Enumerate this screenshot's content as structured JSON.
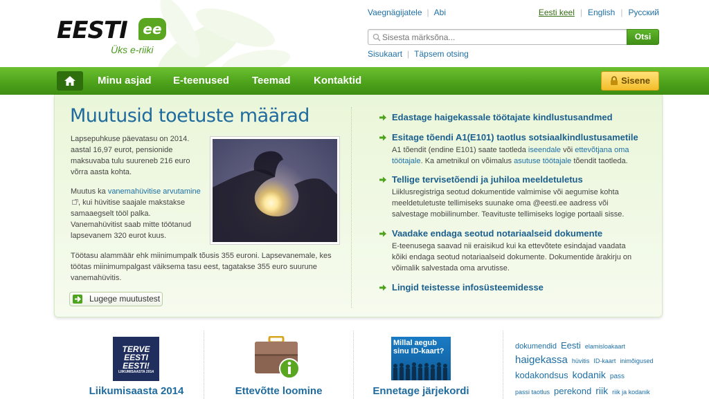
{
  "header": {
    "logo_text": "EESTI",
    "logo_ee": "ee",
    "logo_tagline": "Üks e-riiki",
    "top_links": [
      "Vaegnägijatele",
      "Abi"
    ],
    "languages": [
      {
        "label": "Eesti keel",
        "active": true
      },
      {
        "label": "English",
        "active": false
      },
      {
        "label": "Русский",
        "active": false
      }
    ],
    "search": {
      "placeholder": "Sisesta märksõna...",
      "button": "Otsi"
    },
    "sub_links": [
      "Sisukaart",
      "Täpsem otsing"
    ]
  },
  "nav": {
    "items": [
      "Minu asjad",
      "E-teenused",
      "Teemad",
      "Kontaktid"
    ],
    "login": "Sisene"
  },
  "feature": {
    "title": "Muutusid toetuste määrad",
    "p1": "Lapsepuhkuse päevatasu on 2014. aastal 16,97 eurot, pensionide maksuvaba tulu suureneb 216 euro võrra aasta kohta.",
    "p2_pre": "Muutus ka ",
    "p2_link": "vanemahüvitise arvutamine",
    "p2_post": ", kui hüvitise saajale makstakse samaaegselt tööl palka. Vanemahüvitist saab mitte töötanud lapsevanem 320 eurot kuus.",
    "p3": "Töötasu alammäär ehk miinimumpalk tõusis 355 euroni. Lapsevanemale, kes töötas miinimumpalgast väiksema tasu eest, tagatakse 355 euro suurune vanemahüvitis.",
    "more_button": "Lugege muutustest"
  },
  "services": [
    {
      "title": "Edastage haigekassale töötajate kindlustusandmed"
    },
    {
      "title": "Esitage tõendi A1(E101) taotlus sotsiaalkindlustusametile",
      "d1": "A1 tõendit (endine E101) saate taotleda ",
      "l1": "iseendale",
      "d2": " või ",
      "l2": "ettevõtjana oma töötajale",
      "d3": ". Ka ametnikul on võimalus ",
      "l3": "asutuse töötajale",
      "d4": " tõendit taotleda."
    },
    {
      "title": "Tellige tervisetõendi ja juhiloa meeldetuletus",
      "desc": "Liiklusregistriga seotud dokumentide valmimise või aegumise kohta meeldetuletuste tellimiseks suunake oma @eesti.ee aadress või salvestage mobiilinumber. Teavituste tellimiseks logige portaali sisse."
    },
    {
      "title": "Vaadake endaga seotud notariaalseid dokumente",
      "desc": "E-teenusega saavad nii eraisikud kui ka ettevõtete esindajad vaadata kõiki endaga seotud notariaalseid dokumente. Dokumentide ärakirju on võimalik salvestada oma arvutisse."
    },
    {
      "title": "Lingid teistesse infosüsteemidesse"
    }
  ],
  "promos": [
    {
      "title": "Liikumisaasta 2014",
      "img_lines": [
        "TERVE",
        "EESTI",
        "EESTI!"
      ],
      "img_small": "LIIKUMISAASTA 2014"
    },
    {
      "title": "Ettevõtte loomine"
    },
    {
      "title": "Ennetage järjekordi",
      "img_text": "Millal aegub sinu ID-kaart?"
    }
  ],
  "tags": [
    {
      "t": "dokumendid",
      "s": 11
    },
    {
      "t": "Eesti",
      "s": 13
    },
    {
      "t": "elamisloakaart",
      "s": 9
    },
    {
      "t": "haigekassa",
      "s": 15
    },
    {
      "t": "hüvitis",
      "s": 9
    },
    {
      "t": "ID-kaart",
      "s": 9
    },
    {
      "t": "inimõigused",
      "s": 9
    },
    {
      "t": "kodakondsus",
      "s": 13
    },
    {
      "t": "kodanik",
      "s": 14
    },
    {
      "t": "pass",
      "s": 10
    },
    {
      "t": "passi taotlus",
      "s": 9
    },
    {
      "t": "perekond",
      "s": 13
    },
    {
      "t": "riik",
      "s": 14
    },
    {
      "t": "riik ja kodanik",
      "s": 9
    }
  ],
  "colors": {
    "brand_green": "#4ea31c",
    "link_blue": "#1d6fa5",
    "title_blue": "#1f6b9e",
    "login_yellow": "#f3bd2a"
  }
}
